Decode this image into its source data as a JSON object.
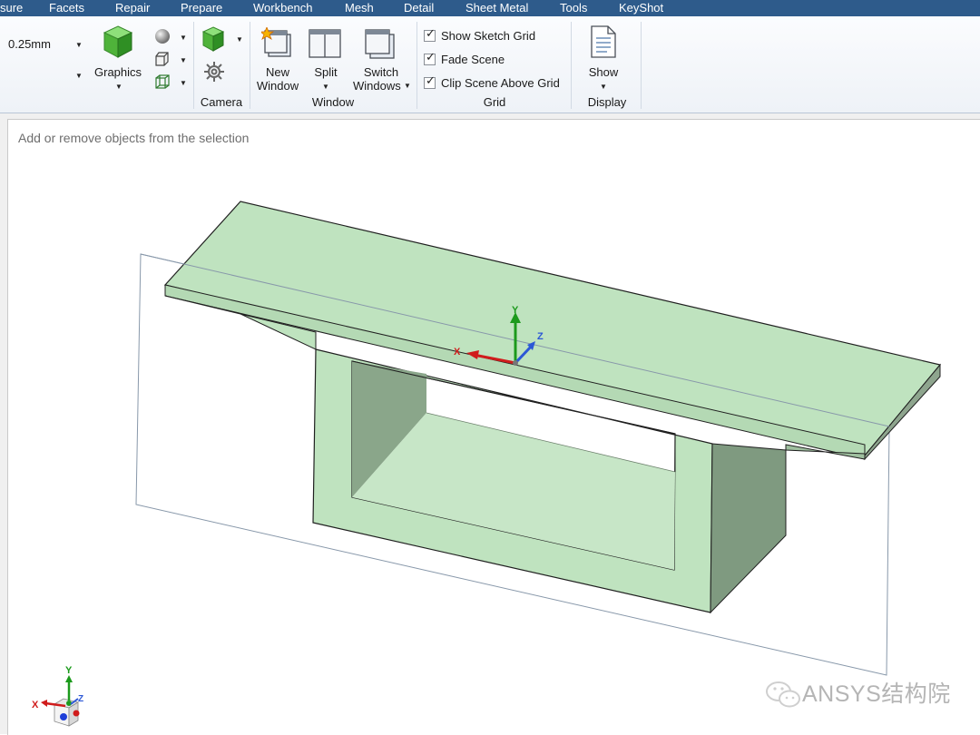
{
  "menu": {
    "items": [
      "sure",
      "Facets",
      "Repair",
      "Prepare",
      "Workbench",
      "Mesh",
      "Detail",
      "Sheet Metal",
      "Tools",
      "KeyShot"
    ]
  },
  "ribbon": {
    "size_value": "0.25mm",
    "graphics_label": "Graphics",
    "camera_label": "Camera",
    "new_window_line1": "New",
    "new_window_line2": "Window",
    "split_label": "Split",
    "switch_windows_line1": "Switch",
    "switch_windows_line2": "Windows",
    "window_group_label": "Window",
    "grid": {
      "show_sketch_grid": {
        "label": "Show Sketch Grid",
        "checked": true
      },
      "fade_scene": {
        "label": "Fade Scene",
        "checked": true
      },
      "clip_scene": {
        "label": "Clip Scene Above Grid",
        "checked": true
      },
      "group_label": "Grid"
    },
    "show_label": "Show",
    "display_group_label": "Display"
  },
  "viewport": {
    "hint": "Add or remove objects from the selection",
    "axis_labels": {
      "x": "X",
      "y": "Y",
      "z": "Z"
    },
    "model_color": "#bfe3bf",
    "model_shade_color": "#7f9a80"
  },
  "watermark": "ANSYS结构院"
}
